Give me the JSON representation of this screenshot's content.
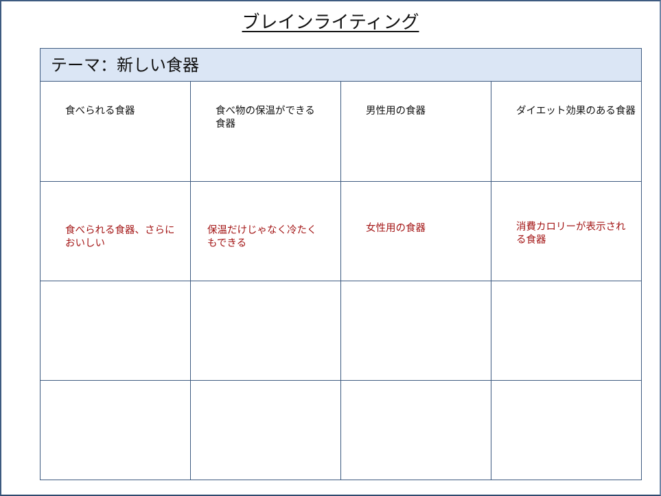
{
  "title": "ブレインライティング",
  "theme": "テーマ：新しい食器",
  "rows": [
    [
      "食べられる食器",
      "食べ物の保温ができる\n食器",
      "男性用の食器",
      "ダイエット効果のある食器"
    ],
    [
      "食べられる食器、さらに\nおいしい",
      "保温だけじゃなく冷たく\nもできる",
      "女性用の食器",
      "消費カロリーが表示され\nる食器"
    ],
    [
      "",
      "",
      "",
      ""
    ],
    [
      "",
      "",
      "",
      ""
    ]
  ],
  "colors": {
    "border": "#3d5a80",
    "theme_background": "#dbe6f5",
    "idea_round1_text": "#111111",
    "idea_round2_text": "#a31515"
  }
}
